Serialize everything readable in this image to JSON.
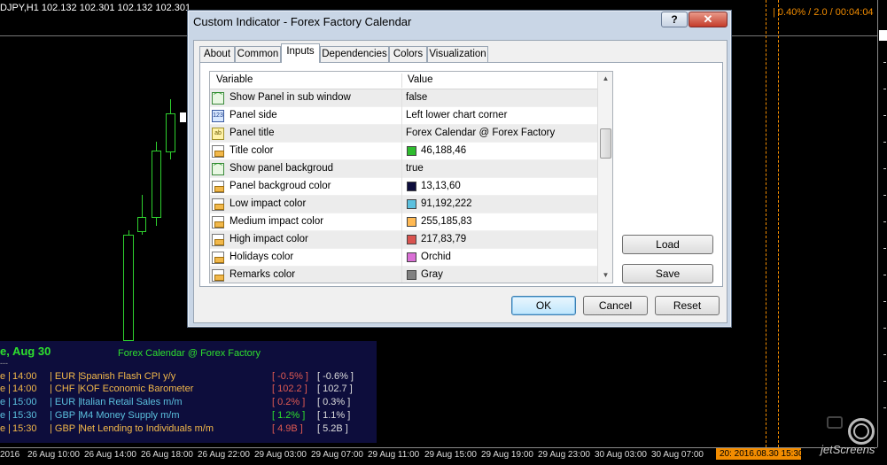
{
  "chart": {
    "symbol_line": "DJPY,H1  102.132 102.301 102.132 102.301",
    "stats": "| 0.40% / 2.0 / 00:04:04",
    "current_time": "20: 2016.08.30 15:30"
  },
  "watermark": "jetScreens",
  "time_axis": [
    "2016",
    "26 Aug 10:00",
    "26 Aug 14:00",
    "26 Aug 18:00",
    "26 Aug 22:00",
    "29 Aug 03:00",
    "29 Aug 07:00",
    "29 Aug 11:00",
    "29 Aug 15:00",
    "29 Aug 19:00",
    "29 Aug 23:00",
    "30 Aug 03:00",
    "30 Aug 07:00"
  ],
  "calendar": {
    "date_header": "e, Aug 30",
    "title": "Forex Calendar @ Forex Factory",
    "divider": "---",
    "events": [
      {
        "sep0": "e  |",
        "time": "14:00",
        "currency": "|  EUR  |",
        "title": "Spanish Flash CPI y/y",
        "actual": "[ -0.5% ]",
        "previous": "[ -0.6% ]"
      },
      {
        "sep0": "e  |",
        "time": "14:00",
        "currency": "|  CHF  |",
        "title": "KOF Economic Barometer",
        "actual": "[ 102.2 ]",
        "previous": "[ 102.7 ]"
      },
      {
        "sep0": "e  |",
        "time": "15:00",
        "currency": "|  EUR  |",
        "title": "Italian Retail Sales m/m",
        "actual": "[ 0.2% ]",
        "previous": "[ 0.3% ]"
      },
      {
        "sep0": "e  |",
        "time": "15:30",
        "currency": "|  GBP  |",
        "title": "M4 Money Supply m/m",
        "actual": "[ 1.2% ]",
        "previous": "[ 1.1% ]"
      },
      {
        "sep0": "e  |",
        "time": "15:30",
        "currency": "|  GBP  |",
        "title": "Net Lending to Individuals m/m",
        "actual": "[ 4.9B ]",
        "previous": "[ 5.2B ]"
      }
    ]
  },
  "dialog": {
    "title": "Custom Indicator - Forex Factory Calendar",
    "help_label": "?",
    "close_label": "✕",
    "tabs": [
      "About",
      "Common",
      "Inputs",
      "Dependencies",
      "Colors",
      "Visualization"
    ],
    "active_tab": "Inputs",
    "grid": {
      "headers": [
        "Variable",
        "Value"
      ],
      "rows": [
        {
          "type": "bool",
          "name": "Show Panel in sub window",
          "value": "false"
        },
        {
          "type": "int",
          "name": "Panel side",
          "value": "Left lower chart corner"
        },
        {
          "type": "string",
          "name": "Panel title",
          "value": "Forex Calendar @ Forex Factory"
        },
        {
          "type": "color",
          "name": "Title color",
          "value": "46,188,46",
          "swatch": "#2EBC2E"
        },
        {
          "type": "bool",
          "name": "Show panel backgroud",
          "value": "true"
        },
        {
          "type": "color",
          "name": "Panel backgroud color",
          "value": "13,13,60",
          "swatch": "#0D0D3C"
        },
        {
          "type": "color",
          "name": "Low impact color",
          "value": "91,192,222",
          "swatch": "#5BC0DE"
        },
        {
          "type": "color",
          "name": "Medium impact color",
          "value": "255,185,83",
          "swatch": "#FFB953"
        },
        {
          "type": "color",
          "name": "High impact color",
          "value": "217,83,79",
          "swatch": "#D9534F"
        },
        {
          "type": "color",
          "name": "Holidays color",
          "value": "Orchid",
          "swatch": "#DA70D6"
        },
        {
          "type": "color",
          "name": "Remarks color",
          "value": "Gray",
          "swatch": "#808080"
        }
      ]
    },
    "load_label": "Load",
    "save_label": "Save",
    "ok_label": "OK",
    "cancel_label": "Cancel",
    "reset_label": "Reset"
  },
  "colors": {
    "chart_background": "#000000",
    "candle": "#2ED12E",
    "separator": "#F28C00",
    "panel_background": "#0D0D3C",
    "dialog_frame": "#C9D6E6"
  }
}
